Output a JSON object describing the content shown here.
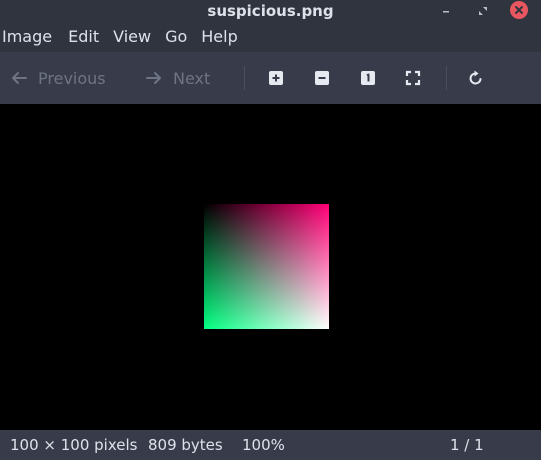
{
  "window": {
    "title": "suspicious.png",
    "buttons": {
      "minimize_icon": "minimize-icon",
      "restore_icon": "restore-icon",
      "close_icon": "close-icon",
      "close_color": "#e8575f"
    }
  },
  "menubar": {
    "items": [
      "Image",
      "Edit",
      "View",
      "Go",
      "Help"
    ]
  },
  "toolbar": {
    "previous_label": "Previous",
    "next_label": "Next",
    "icons": [
      "arrow-left-icon",
      "arrow-right-icon",
      "zoom-in-icon",
      "zoom-out-icon",
      "actual-size-icon",
      "fit-window-icon",
      "rotate-icon"
    ],
    "disabled_color": "#6e7484"
  },
  "image": {
    "description_colors": {
      "top_left": "#000000",
      "top_right": "#ff0077",
      "bottom_left": "#00ff80",
      "bottom_right": "#ffffff"
    }
  },
  "statusbar": {
    "dimensions": "100 × 100 pixels",
    "file_size": "809 bytes",
    "zoom": "100%",
    "position": "1 / 1"
  },
  "colors": {
    "titlebar_bg": "#2f343f",
    "toolbar_bg": "#383c4a",
    "canvas_bg": "#000000",
    "text": "#dde2ea"
  }
}
